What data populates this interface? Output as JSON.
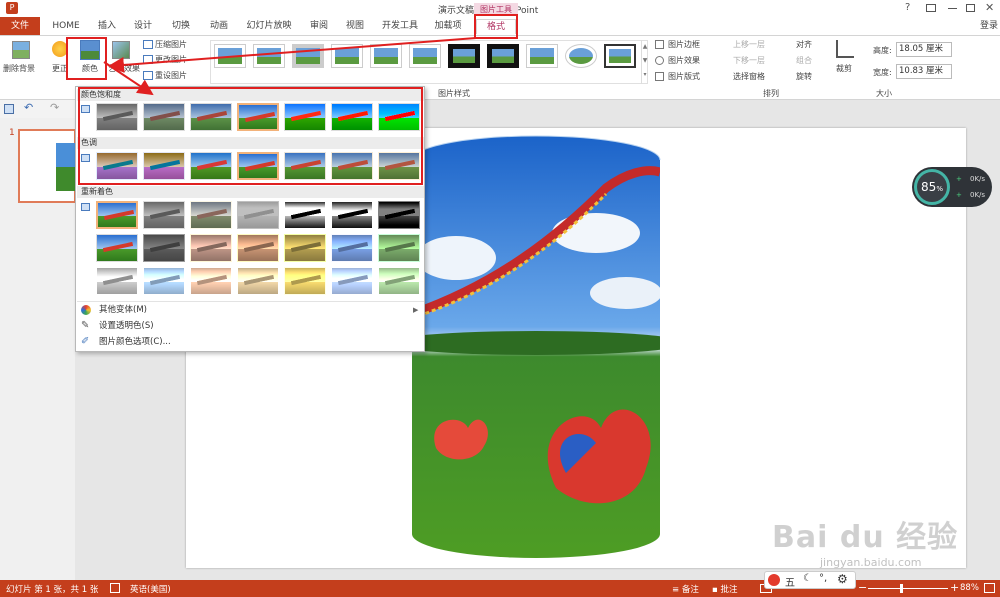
{
  "window": {
    "title": "演示文稿1 - PowerPoint",
    "help": "?",
    "login": "登录"
  },
  "tools_label": "图片工具",
  "tabs": [
    "文件",
    "HOME",
    "插入",
    "设计",
    "切换",
    "动画",
    "幻灯片放映",
    "审阅",
    "视图",
    "开发工具",
    "加载项",
    "格式"
  ],
  "ribbon": {
    "remove_bg": "删除背景",
    "corrections": "更正",
    "color": "颜色",
    "artistic": "艺术效果",
    "compress": "压缩图片",
    "change_pic": "更改图片",
    "reset_pic": "重设图片",
    "pic_border": "图片边框",
    "pic_effect": "图片效果",
    "pic_layout": "图片版式",
    "styles_group": "图片样式",
    "bring_forward": "上移一层",
    "send_backward": "下移一层",
    "selection_pane": "选择窗格",
    "align": "对齐",
    "group": "组合",
    "rotate": "旋转",
    "arrange_group": "排列",
    "crop": "裁剪",
    "height_label": "高度:",
    "height_value": "18.05 厘米",
    "width_label": "宽度:",
    "width_value": "10.83 厘米",
    "size_group": "大小"
  },
  "dropdown": {
    "saturation_title": "颜色饱和度",
    "tone_title": "色调",
    "recolor_title": "重新着色",
    "more_variants": "其他变体(M)",
    "set_transparent": "设置透明色(S)",
    "color_options": "图片颜色选项(C)..."
  },
  "slide_number": "1",
  "status": {
    "slide_info": "幻灯片 第 1 张，共 1 张",
    "language": "英语(美国)",
    "notes": "备注",
    "comments": "批注",
    "zoom": "88%"
  },
  "net_widget": {
    "percent": "85",
    "percent_unit": "%",
    "up": "0K/s",
    "down": "0K/s"
  },
  "ime": {
    "label": "五"
  },
  "watermark": {
    "text": "Bai du 经验",
    "url": "jingyan.baidu.com"
  },
  "colors": {
    "accent": "#c43e1c",
    "highlight": "#e02020",
    "tools": "#d24f7a"
  }
}
